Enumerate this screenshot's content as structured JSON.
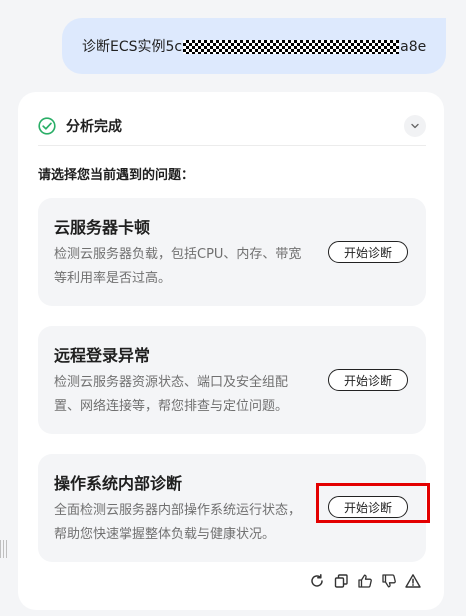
{
  "user_message": {
    "prefix": "诊断ECS实例5c",
    "suffix": "a8e"
  },
  "result": {
    "status": "分析完成",
    "prompt": "请选择您当前遇到的问题："
  },
  "options": [
    {
      "title": "云服务器卡顿",
      "desc": "检测云服务器负载，包括CPU、内存、带宽等利用率是否过高。",
      "button": "开始诊断"
    },
    {
      "title": "远程登录异常",
      "desc": "检测云服务器资源状态、端口及安全组配置、网络连接等，帮您排查与定位问题。",
      "button": "开始诊断"
    },
    {
      "title": "操作系统内部诊断",
      "desc": "全面检测云服务器内部操作系统运行状态，帮助您快速掌握整体负载与健康状况。",
      "button": "开始诊断"
    }
  ],
  "colors": {
    "accent_green": "#2aae67",
    "highlight_red": "#e30000",
    "bubble_blue": "#dde9fd"
  },
  "icons": [
    "refresh-icon",
    "copy-icon",
    "thumbs-up-icon",
    "thumbs-down-icon",
    "warning-icon"
  ]
}
